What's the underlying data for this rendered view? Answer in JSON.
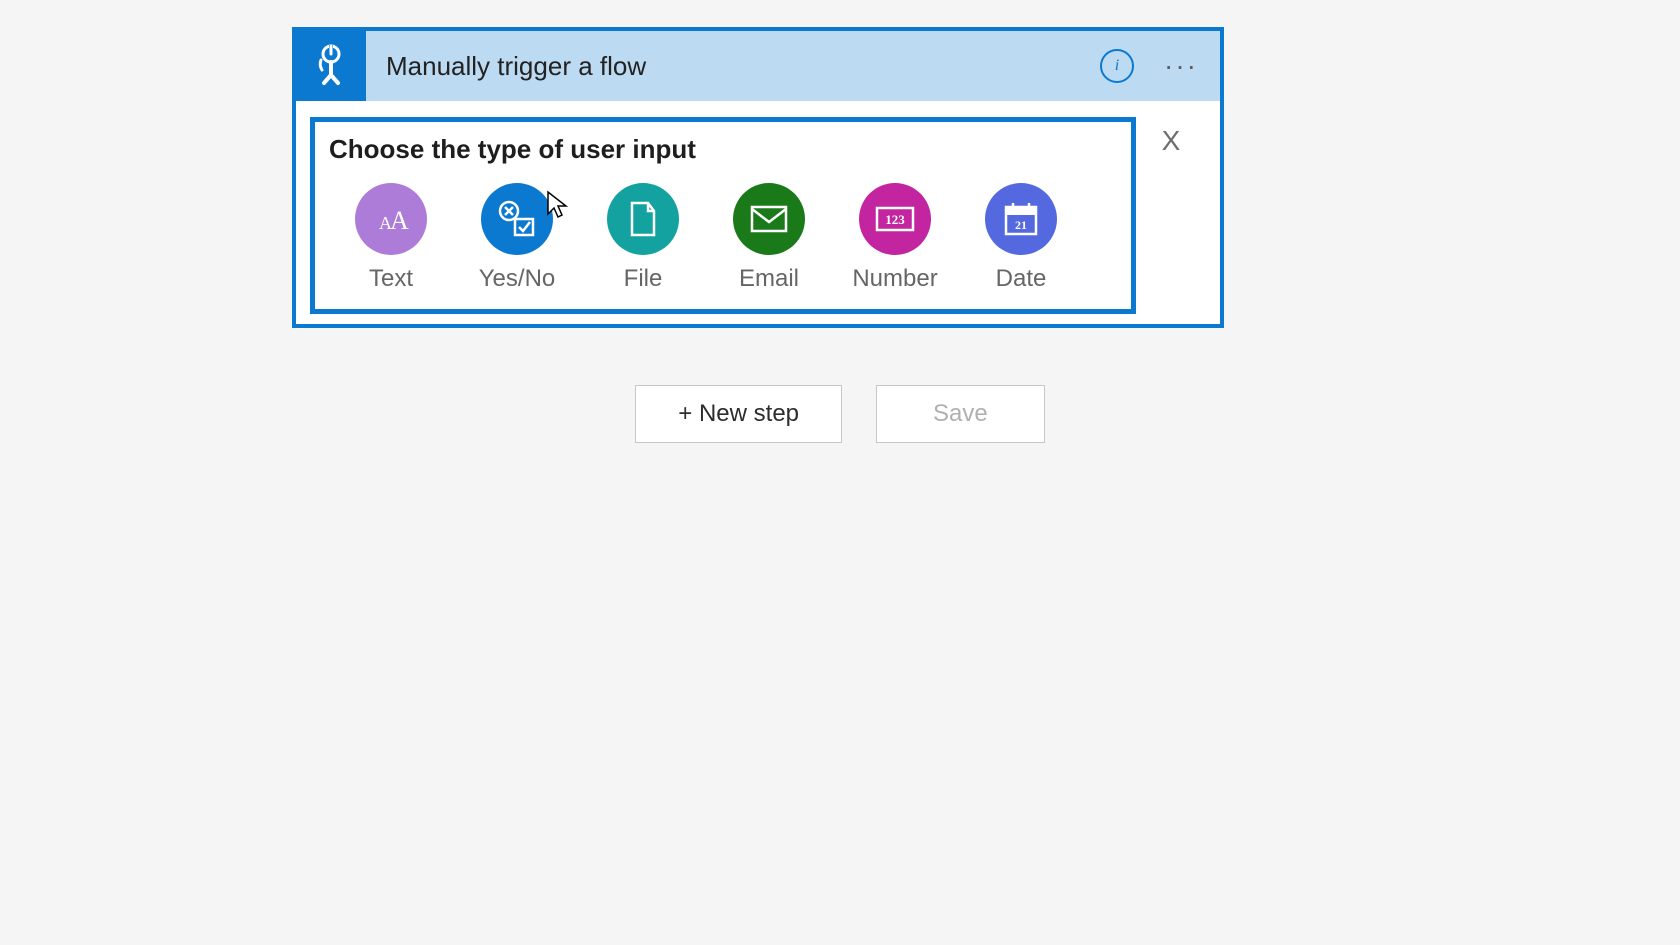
{
  "card": {
    "title": "Manually trigger a flow",
    "panel_title": "Choose the type of user input",
    "close_label": "X",
    "options": [
      {
        "label": "Text"
      },
      {
        "label": "Yes/No"
      },
      {
        "label": "File"
      },
      {
        "label": "Email"
      },
      {
        "label": "Number"
      },
      {
        "label": "Date"
      }
    ]
  },
  "actions": {
    "new_step": "+ New step",
    "save": "Save"
  }
}
